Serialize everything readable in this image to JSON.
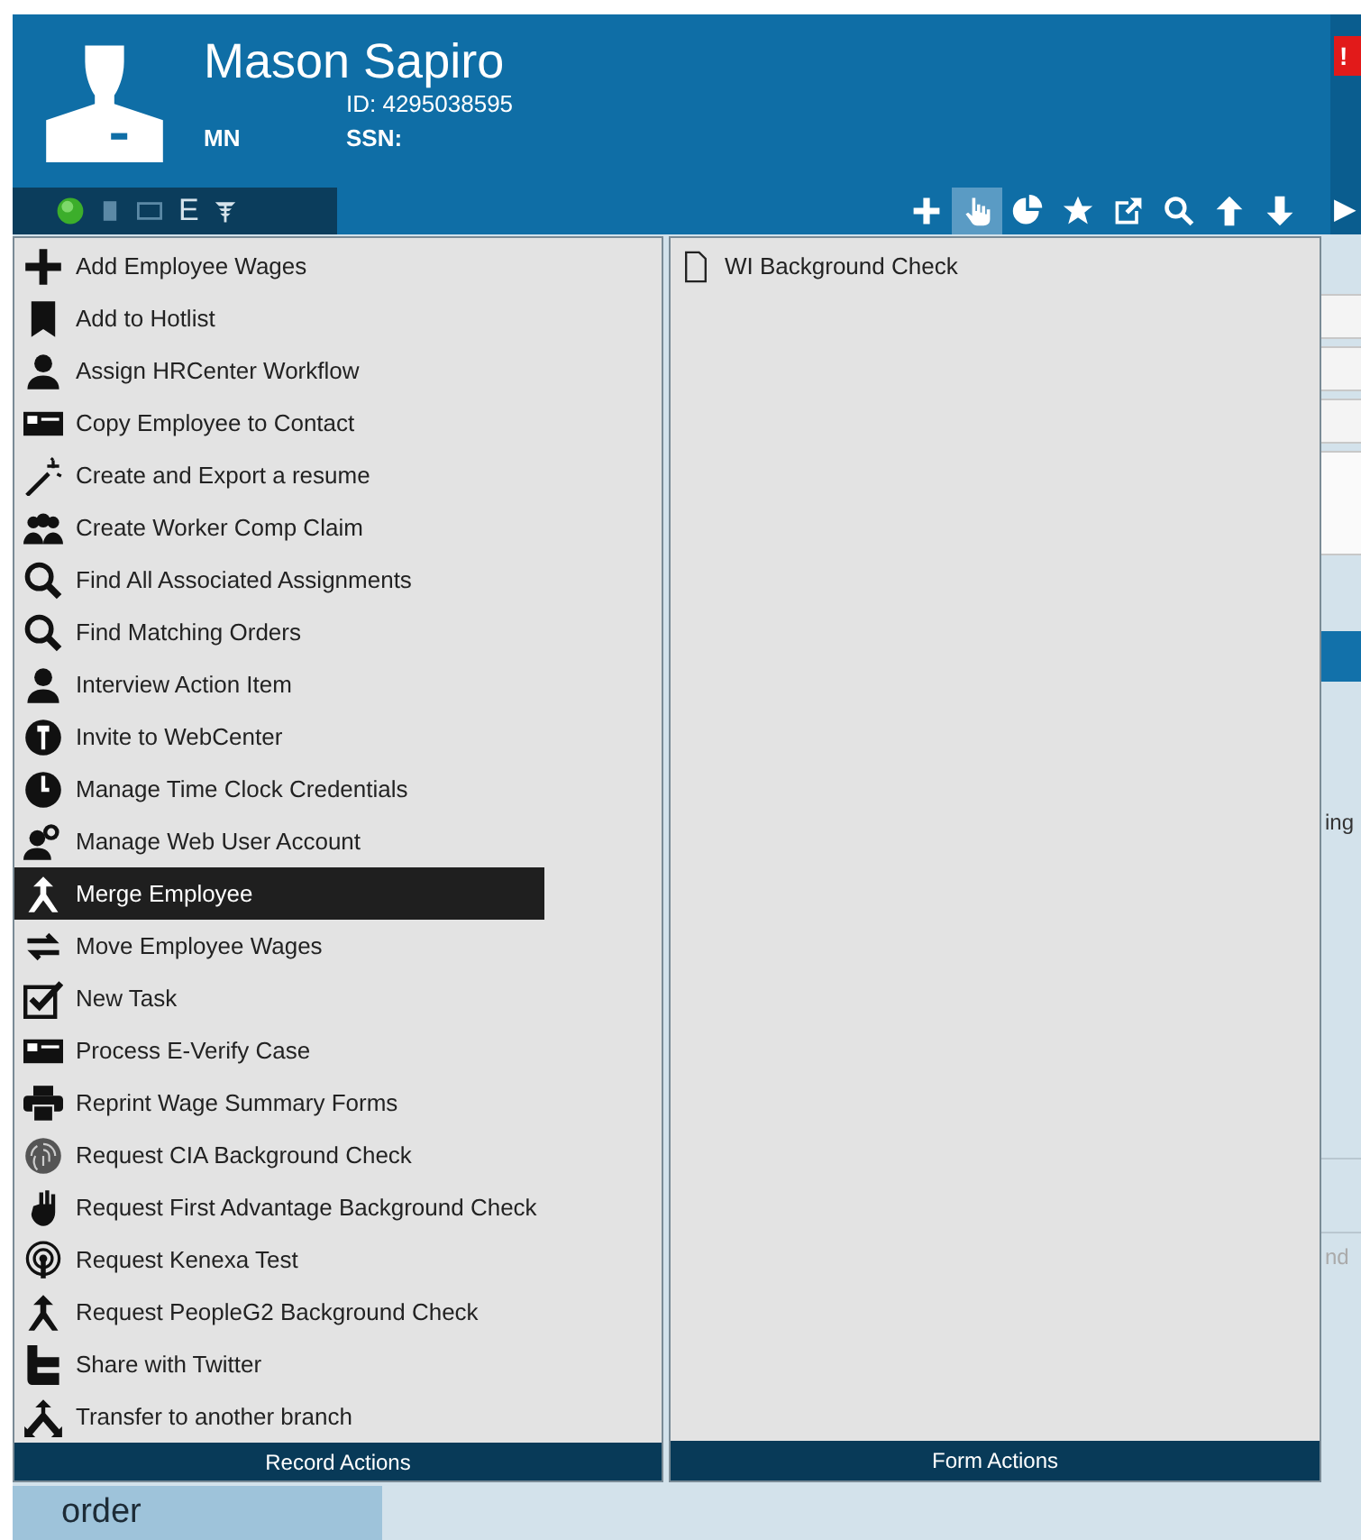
{
  "header": {
    "name": "Mason Sapiro",
    "id_text": "ID: 4295038595",
    "state": "MN",
    "ssn_text": "SSN:"
  },
  "status_strip": {
    "letter": "E"
  },
  "toolbar": {
    "buttons": [
      {
        "selected": false
      },
      {
        "selected": true
      },
      {
        "selected": false
      },
      {
        "selected": false
      },
      {
        "selected": false
      },
      {
        "selected": false
      },
      {
        "selected": false
      },
      {
        "selected": false
      }
    ],
    "more": "▶"
  },
  "alert_badge": "!",
  "record_actions": {
    "title": "Record Actions",
    "items": [
      {
        "label": "Add Employee Wages",
        "selected": false
      },
      {
        "label": "Add to Hotlist",
        "selected": false
      },
      {
        "label": "Assign HRCenter Workflow",
        "selected": false
      },
      {
        "label": "Copy Employee to Contact",
        "selected": false
      },
      {
        "label": "Create and Export a resume",
        "selected": false
      },
      {
        "label": "Create Worker Comp Claim",
        "selected": false
      },
      {
        "label": "Find All Associated Assignments",
        "selected": false
      },
      {
        "label": "Find Matching Orders",
        "selected": false
      },
      {
        "label": "Interview Action Item",
        "selected": false
      },
      {
        "label": "Invite to WebCenter",
        "selected": false
      },
      {
        "label": "Manage Time Clock Credentials",
        "selected": false
      },
      {
        "label": "Manage Web User Account",
        "selected": false
      },
      {
        "label": "Merge Employee",
        "selected": true
      },
      {
        "label": "Move Employee Wages",
        "selected": false
      },
      {
        "label": "New Task",
        "selected": false
      },
      {
        "label": "Process E-Verify Case",
        "selected": false
      },
      {
        "label": "Reprint Wage Summary Forms",
        "selected": false
      },
      {
        "label": "Request CIA Background Check",
        "selected": false
      },
      {
        "label": "Request First Advantage Background Check",
        "selected": false
      },
      {
        "label": "Request Kenexa Test",
        "selected": false
      },
      {
        "label": "Request PeopleG2 Background Check",
        "selected": false
      },
      {
        "label": "Share with Twitter",
        "selected": false
      },
      {
        "label": "Transfer to another branch",
        "selected": false
      }
    ]
  },
  "form_actions": {
    "title": "Form Actions",
    "items": [
      {
        "label": "WI Background Check"
      }
    ]
  },
  "background": {
    "fragments": [
      "ing",
      "nd"
    ],
    "tab": "order"
  }
}
